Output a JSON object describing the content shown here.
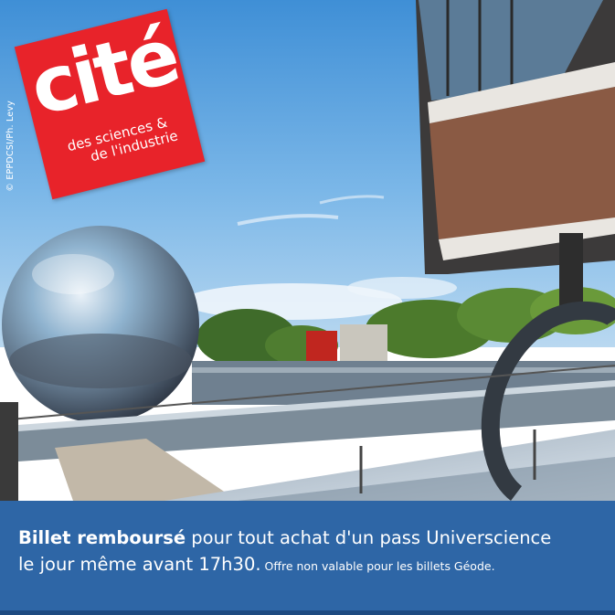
{
  "credit": "© EPPDCSI/Ph. Levy",
  "logo": {
    "word": "cité",
    "line1": "des sciences &",
    "line2": "de l'industrie"
  },
  "banner": {
    "bold_text": "Billet remboursé",
    "text1": " pour tout achat d'un pass Universcience",
    "text2": "le jour même avant 17h30.",
    "small_text": " Offre non valable pour les billets Géode."
  },
  "colors": {
    "logo_red": "#e8232a",
    "banner_blue": "#2e66a6",
    "sky": "#3f8fd6"
  }
}
